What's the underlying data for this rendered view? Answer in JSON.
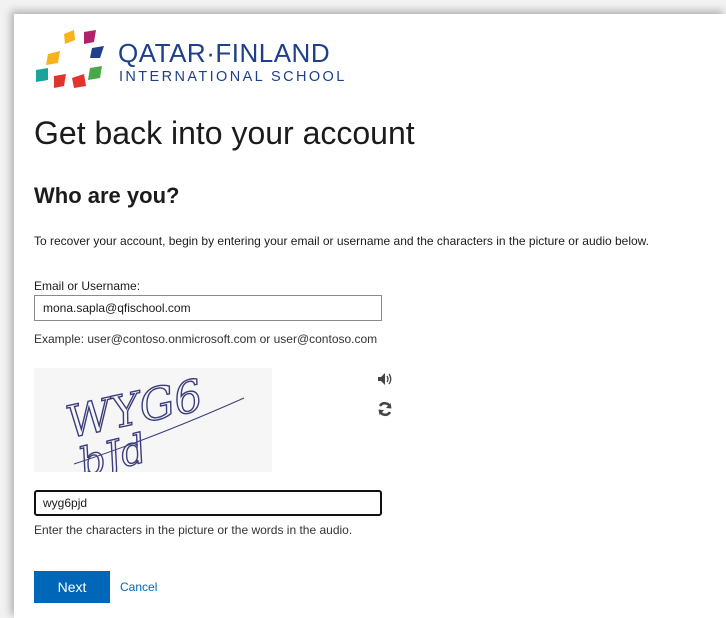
{
  "logo": {
    "name": "QATAR·FINLAND",
    "subtitle": "INTERNATIONAL SCHOOL",
    "colors": {
      "text": "#1f3f8b",
      "yellow": "#f6b41a",
      "magenta": "#b0226a",
      "red": "#e4332d",
      "teal": "#1aa39a",
      "green": "#4aa84a"
    }
  },
  "page": {
    "title": "Get back into your account",
    "subtitle": "Who are you?",
    "description": "To recover your account, begin by entering your email or username and the characters in the picture or audio below."
  },
  "email": {
    "label": "Email or Username:",
    "value": "mona.sapla@qfischool.com",
    "example": "Example: user@contoso.onmicrosoft.com or user@contoso.com"
  },
  "captcha": {
    "image_text": "WYG6 bJd",
    "audio_icon": "speaker-icon",
    "refresh_icon": "refresh-icon",
    "value": "wyg6pjd",
    "hint": "Enter the characters in the picture or the words in the audio."
  },
  "actions": {
    "next_label": "Next",
    "cancel_label": "Cancel",
    "accent": "#0067b8"
  }
}
